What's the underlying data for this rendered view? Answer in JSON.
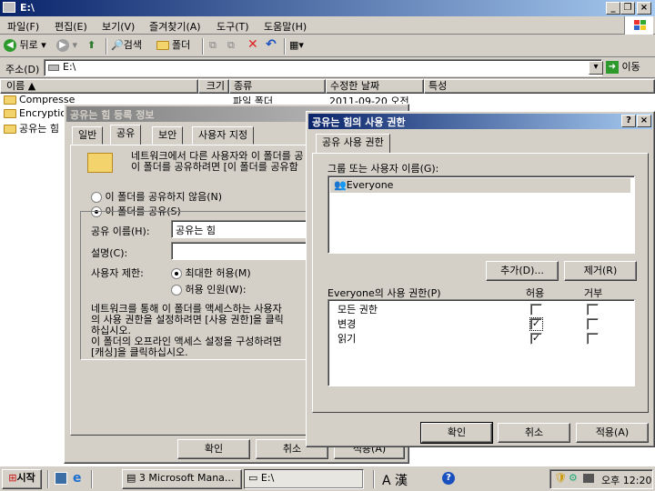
{
  "explorer": {
    "title": "E:\\",
    "menu": [
      "파일(F)",
      "편집(E)",
      "보기(V)",
      "즐겨찾기(A)",
      "도구(T)",
      "도움말(H)"
    ],
    "toolbar": {
      "back": "뒤로",
      "search": "검색",
      "folders": "폴더"
    },
    "address_label": "주소(D)",
    "address_value": "E:\\",
    "go_label": "이동",
    "columns": [
      "이름",
      "크기",
      "종류",
      "수정한 날짜",
      "특성"
    ],
    "files": [
      {
        "name": "Compresse",
        "type": "파일 폴더",
        "date": "2011-09-20 오전"
      },
      {
        "name": "Encryptio",
        "type": "",
        "date": ""
      },
      {
        "name": "공유는 힘",
        "type": "",
        "date": ""
      }
    ]
  },
  "props": {
    "title": "공유는 힘 등록 정보",
    "tabs": [
      "일반",
      "공유",
      "보안",
      "사용자 지정"
    ],
    "intro": "네트워크에서 다른 사용자와 이 폴더를 공\n이 폴더를 공유하려면 [이 폴더를 공유함",
    "no_share": "이 폴더를 공유하지 않음(N)",
    "share": "이 폴더를 공유(S)",
    "share_name_label": "공유 이름(H):",
    "share_name_value": "공유는 힘",
    "desc_label": "설명(C):",
    "user_limit_label": "사용자 제한:",
    "max_allowed": "최대한 허용(M)",
    "allow_users": "허용 인원(W):",
    "perm_info": "네트워크를 통해 이 폴더를 액세스하는 사용자\n의 사용 권한을 설정하려면 [사용 권한]을 클릭\n하십시오.",
    "offline_info": "이 폴더의 오프라인 액세스 설정을 구성하려면\n[캐싱]을 클릭하십시오.",
    "ok": "확인",
    "cancel": "취소",
    "apply": "적용(A)"
  },
  "perm": {
    "title": "공유는 힘의 사용 권한",
    "help": "?",
    "tab": "공유 사용 권한",
    "group_label": "그룹 또는 사용자 이름(G):",
    "users": [
      "Everyone"
    ],
    "add": "추가(D)...",
    "remove": "제거(R)",
    "perm_label": "Everyone의 사용 권한(P)",
    "allow_col": "허용",
    "deny_col": "거부",
    "rows": [
      {
        "name": "모든 권한",
        "allow": false,
        "deny": false
      },
      {
        "name": "변경",
        "allow": true,
        "deny": false
      },
      {
        "name": "읽기",
        "allow": true,
        "deny": false
      }
    ],
    "ok": "확인",
    "cancel": "취소",
    "apply": "적용(A)"
  },
  "taskbar": {
    "start": "시작",
    "items": [
      "3 Microsoft Mana...",
      "E:\\"
    ],
    "ime": "A 漢",
    "time": "오후 12:20"
  }
}
